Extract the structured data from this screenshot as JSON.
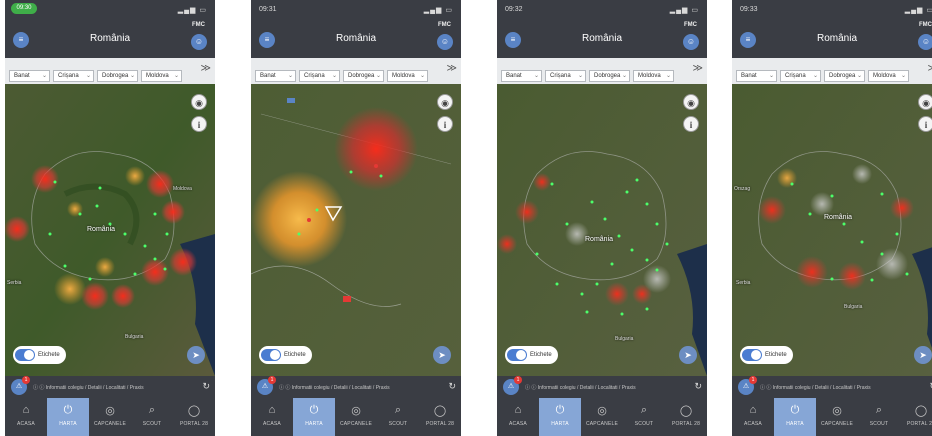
{
  "phones": [
    {
      "id": "phone1",
      "status_time": "09:30",
      "brand": "FMC",
      "header_title": "România",
      "filters": [
        "Banat",
        "Crișana",
        "Dobrogea",
        "Moldova"
      ],
      "map_labels": [
        "România",
        "Moldova",
        "Serbia",
        "Bulgaria"
      ],
      "toggle_label": "Etichete",
      "alert_count": "1",
      "url_text": "ⓘ ⓘ Informatii colegiu / Detalii / Localitati / Praxis",
      "active_tab": 1
    },
    {
      "id": "phone2",
      "status_time": "09:31",
      "brand": "FMC",
      "header_title": "România",
      "filters": [
        "Banat",
        "Crișana",
        "Dobrogea",
        "Moldova"
      ],
      "map_labels": [],
      "toggle_label": "Etichete",
      "alert_count": "1",
      "url_text": "ⓘ ⓘ Informatii colegiu / Detalii / Localitati / Praxis",
      "active_tab": 1
    },
    {
      "id": "phone3",
      "status_time": "09:32",
      "brand": "FMC",
      "header_title": "România",
      "filters": [
        "Banat",
        "Crișana",
        "Dobrogea",
        "Moldova"
      ],
      "map_labels": [
        "România",
        "Bulgaria"
      ],
      "toggle_label": "Etichete",
      "alert_count": "1",
      "url_text": "ⓘ ⓘ Informatii colegiu / Detalii / Localitati / Praxis",
      "active_tab": 1
    },
    {
      "id": "phone4",
      "status_time": "09:33",
      "brand": "FMC",
      "header_title": "România",
      "filters": [
        "Banat",
        "Crișana",
        "Dobrogea",
        "Moldova"
      ],
      "map_labels": [
        "România",
        "Orszag",
        "Serbia",
        "Bulgaria"
      ],
      "toggle_label": "Etichete",
      "alert_count": "1",
      "url_text": "ⓘ ⓘ Informatii colegiu / Detalii / Localitati / Praxis",
      "active_tab": 1
    }
  ],
  "tabs": [
    {
      "label": "ACASA",
      "icon": "home-icon",
      "glyph": "⌂"
    },
    {
      "label": "HARTA",
      "icon": "power-icon",
      "glyph": "⏻"
    },
    {
      "label": "CAPCANELE",
      "icon": "target-icon",
      "glyph": "◎"
    },
    {
      "label": "SCOUT",
      "icon": "search-icon",
      "glyph": "⌕"
    },
    {
      "label": "PORTAL 28",
      "icon": "chat-icon",
      "glyph": "◯"
    }
  ],
  "colors": {
    "topbar": "#3a3d44",
    "accent": "#5a84c5",
    "active_tab": "#86a6d6",
    "heat_red": "#e53935",
    "heat_orange": "#ffa726",
    "point_green": "#4cff6a"
  }
}
